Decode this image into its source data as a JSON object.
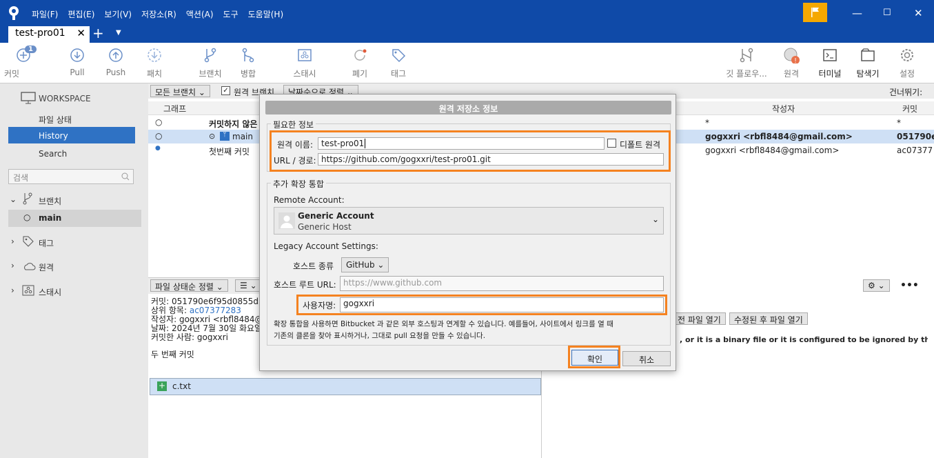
{
  "app": {
    "menus": [
      "파일(F)",
      "편집(E)",
      "보기(V)",
      "저장소(R)",
      "액션(A)",
      "도구",
      "도움말(H)"
    ],
    "tab": "test-pro01"
  },
  "toolbar": {
    "commit": "커밋",
    "commit_badge": "1",
    "pull": "Pull",
    "push": "Push",
    "fetch": "패치",
    "branch": "브랜치",
    "merge": "병합",
    "stash": "스태시",
    "discard": "폐기",
    "tag": "태그",
    "gitflow": "깃 플로우...",
    "remote": "원격",
    "terminal": "터미널",
    "explorer": "탐색기",
    "settings": "설정"
  },
  "sidebar": {
    "workspace": "WORKSPACE",
    "file_status": "파일 상태",
    "history": "History",
    "search": "Search",
    "search_placeholder": "검색",
    "branches": "브랜치",
    "main": "main",
    "tags": "태그",
    "remotes": "원격",
    "stashes": "스태시"
  },
  "filter": {
    "all_branches": "모든 브랜치",
    "remote_branches": "원격 브랜치",
    "date_order": "날짜순으로 정렬",
    "skip": "건너뛰기:"
  },
  "columns": {
    "graph": "그래프",
    "author": "작성자",
    "commit": "커밋"
  },
  "commits": [
    {
      "desc": "커밋하지 않은",
      "author": "*",
      "hash": "*"
    },
    {
      "desc": "main",
      "author": "gogxxri <rbfl8484@gmail.com>",
      "hash": "051790e"
    },
    {
      "desc": "첫번째 커밋",
      "author": "gogxxri <rbfl8484@gmail.com>",
      "hash": "ac07377"
    }
  ],
  "lower": {
    "sort": "파일 상태순 정렬",
    "file": "c.txt",
    "commit_line": "커밋: 051790e6f95d0855d30",
    "parent_label": "상위 항목:",
    "parent": "ac07377283",
    "author_line": "작성자: gogxxri <rbfl8484@g",
    "date_line": "날짜: 2024년 7월 30일 화요일",
    "committer_line": "커밋한 사람: gogxxri",
    "message": "두 번째 커밋",
    "open_before": "전 파일 열기",
    "open_after": "수정된 후 파일 열기",
    "binary_msg": ", or it is a binary file or it is configured to be ignored by the file pa"
  },
  "dialog": {
    "title": "원격 저장소 정보",
    "required": "필요한 정보",
    "remote_name_label": "원격 이름:",
    "remote_name": "test-pro01",
    "default_remote": "디폴트 원격",
    "url_label": "URL / 경로:",
    "url": "https://github.com/gogxxri/test-pro01.git",
    "extended": "추가 확장 통합",
    "remote_account_label": "Remote Account:",
    "account_name": "Generic Account",
    "account_host": "Generic Host",
    "legacy": "Legacy Account Settings:",
    "host_type_label": "호스트 종류",
    "host_type": "GitHub",
    "host_root_label": "호스트 루트 URL:",
    "host_root_placeholder": "https://www.github.com",
    "username_label": "사용자명:",
    "username": "gogxxri",
    "info1": "확장 통합을 사용하면 Bitbucket 과 같은 외부 호스팅과 연계할 수 있습니다. 예를들어, 사이트에서 링크를 열 때",
    "info2": "기존의 클론을 찾아 표시하거나, 그대로 pull 요청을 만들 수 있습니다.",
    "ok": "확인",
    "cancel": "취소"
  },
  "colors": {
    "titlebar": "#0f4aa8",
    "highlight": "#f58220",
    "flag": "#f5a800"
  }
}
